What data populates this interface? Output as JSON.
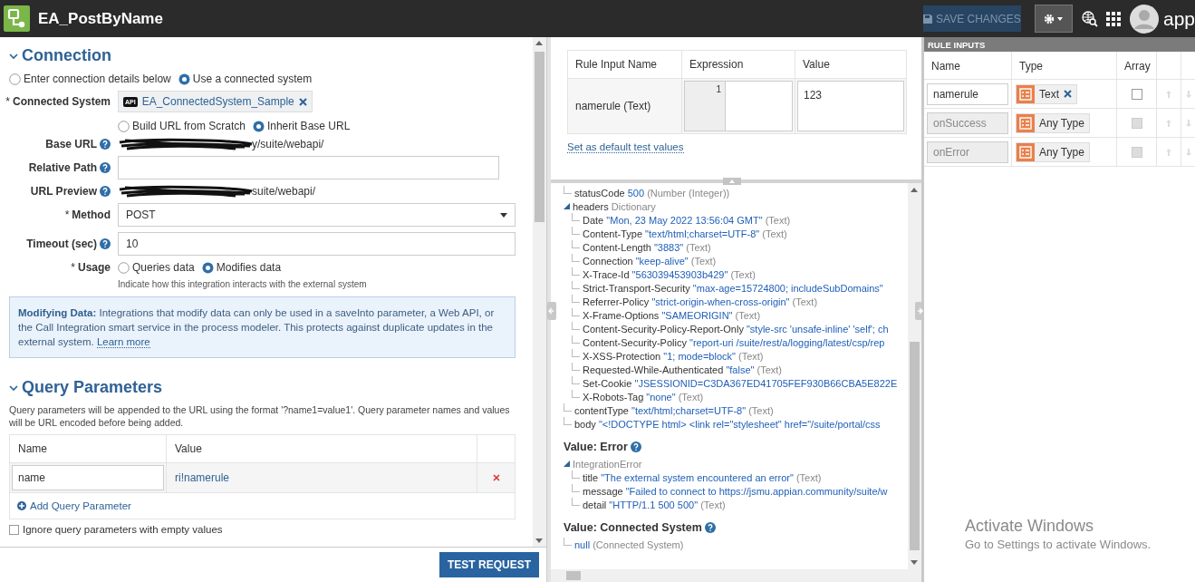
{
  "header": {
    "title": "EA_PostByName",
    "save_button": "SAVE CHANGES",
    "logo_text": "app"
  },
  "connection": {
    "title": "Connection",
    "expanded": true,
    "source_options": [
      {
        "label": "Enter connection details below",
        "selected": false
      },
      {
        "label": "Use a connected system",
        "selected": true
      }
    ],
    "connected_system": {
      "mark": "*",
      "label": "Connected System",
      "badge": "API",
      "value": "EA_ConnectedSystem_Sample"
    },
    "url_mode": [
      {
        "label": "Build URL from Scratch",
        "selected": false
      },
      {
        "label": "Inherit Base URL",
        "selected": true
      }
    ],
    "base_url": {
      "label": "Base URL",
      "value": "y/suite/webapi/"
    },
    "relative_path": {
      "label": "Relative Path"
    },
    "url_preview": {
      "label": "URL Preview",
      "value": "suite/webapi/"
    },
    "method": {
      "mark": "*",
      "label": "Method",
      "value": "POST"
    },
    "timeout": {
      "label": "Timeout (sec)",
      "value": "10"
    },
    "usage": {
      "mark": "*",
      "label": "Usage",
      "options": [
        {
          "label": "Queries data",
          "selected": false
        },
        {
          "label": "Modifies data",
          "selected": true
        }
      ],
      "hint": "Indicate how this integration interacts with the external system"
    },
    "info": {
      "text": "**Modifying Data:** Integrations that modify data can only be used in a saveInto parameter, a Web API, or the Call Integration smart service in the process modeler. This protects against duplicate updates in the external system.",
      "link": "Learn more"
    }
  },
  "query_parameters": {
    "title": "Query Parameters",
    "expanded": true,
    "description": "Query parameters will be appended to the URL using the format '?name1=value1'. Query parameter names and values will be URL encoded before being added.",
    "columns": [
      "Name",
      "Value"
    ],
    "rows": [
      {
        "name": "name",
        "value": "ri!namerule"
      }
    ],
    "add_label": "Add Query Parameter",
    "ignore_empty": {
      "label": "Ignore query parameters with empty values",
      "checked": false
    }
  },
  "test_button": "TEST REQUEST",
  "rule_test": {
    "columns": [
      "Rule Input Name",
      "Expression",
      "Value"
    ],
    "rows": [
      {
        "name": "namerule (Text)",
        "line_number": "1",
        "value": "123"
      }
    ],
    "link": "Set as default test values"
  },
  "result_sections": [
    {
      "nodes": [
        {
          "key": "statusCode",
          "value": "500",
          "type": "(Number (Integer))"
        },
        {
          "key": "headers",
          "type": "Dictionary",
          "expanded": true,
          "children": [
            {
              "key": "Date",
              "value": "\"Mon, 23 May 2022 13:56:04 GMT\"",
              "type": "(Text)"
            },
            {
              "key": "Content-Type",
              "value": "\"text/html;charset=UTF-8\"",
              "type": "(Text)"
            },
            {
              "key": "Content-Length",
              "value": "\"3883\"",
              "type": "(Text)"
            },
            {
              "key": "Connection",
              "value": "\"keep-alive\"",
              "type": "(Text)"
            },
            {
              "key": "X-Trace-Id",
              "value": "\"563039453903b429\"",
              "type": "(Text)"
            },
            {
              "key": "Strict-Transport-Security",
              "value": "\"max-age=15724800; includeSubDomains\""
            },
            {
              "key": "Referrer-Policy",
              "value": "\"strict-origin-when-cross-origin\"",
              "type": "(Text)"
            },
            {
              "key": "X-Frame-Options",
              "value": "\"SAMEORIGIN\"",
              "type": "(Text)"
            },
            {
              "key": "Content-Security-Policy-Report-Only",
              "value": "\"style-src 'unsafe-inline' 'self'; ch"
            },
            {
              "key": "Content-Security-Policy",
              "value": "\"report-uri /suite/rest/a/logging/latest/csp/rep"
            },
            {
              "key": "X-XSS-Protection",
              "value": "\"1; mode=block\"",
              "type": "(Text)"
            },
            {
              "key": "Requested-While-Authenticated",
              "value": "\"false\"",
              "type": "(Text)"
            },
            {
              "key": "Set-Cookie",
              "value": "\"JSESSIONID=C3DA367ED41705FEF930B66CBA5E822E"
            },
            {
              "key": "X-Robots-Tag",
              "value": "\"none\"",
              "type": "(Text)"
            }
          ]
        },
        {
          "key": "contentType",
          "value": "\"text/html;charset=UTF-8\"",
          "type": "(Text)"
        },
        {
          "key": "body",
          "value": "\"<!DOCTYPE html> <link rel=\"stylesheet\" href=\"/suite/portal/css"
        }
      ]
    },
    {
      "title": "Value: Error",
      "nodes": [
        {
          "type": "IntegrationError",
          "expanded": true,
          "children": [
            {
              "key": "title",
              "value": "\"The external system encountered an error\"",
              "type": "(Text)"
            },
            {
              "key": "message",
              "value": "\"Failed to connect to https://jsmu.appian.community/suite/w"
            },
            {
              "key": "detail",
              "value": "\"HTTP/1.1 500 500\"",
              "type": "(Text)"
            }
          ]
        }
      ]
    },
    {
      "title": "Value: Connected System",
      "nodes": [
        {
          "value": "null",
          "type": "(Connected System)"
        }
      ]
    }
  ],
  "rule_inputs": {
    "title": "RULE INPUTS",
    "columns": [
      "Name",
      "Type",
      "Array"
    ],
    "rows": [
      {
        "name": "namerule",
        "type": "Text",
        "editable": true,
        "removable": true,
        "array": false
      },
      {
        "name": "onSuccess",
        "type": "Any Type",
        "editable": false,
        "removable": false,
        "array": false
      },
      {
        "name": "onError",
        "type": "Any Type",
        "editable": false,
        "removable": false,
        "array": false
      }
    ]
  },
  "os_notice": {
    "title": "Activate Windows",
    "text": "Go to Settings to activate Windows."
  }
}
